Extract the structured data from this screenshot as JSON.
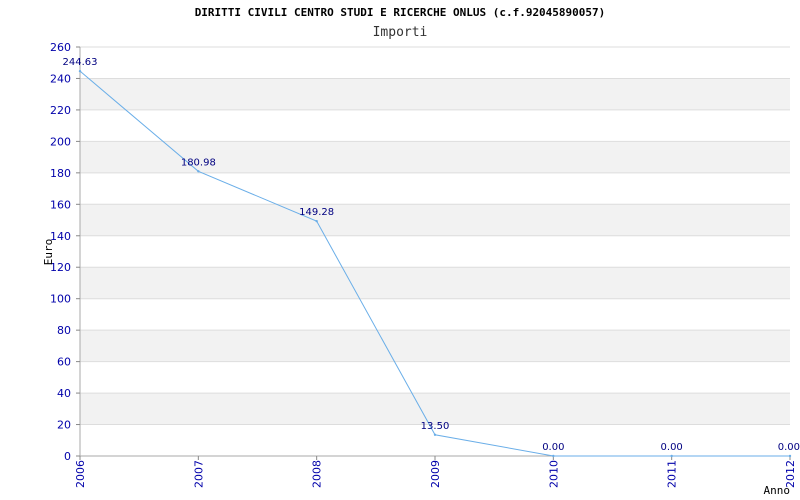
{
  "chart_data": {
    "type": "line",
    "title": "DIRITTI CIVILI CENTRO STUDI E RICERCHE ONLUS (c.f.92045890057)",
    "subtitle": "Importi",
    "xlabel": "Anno",
    "ylabel": "Euro",
    "x": [
      "2006",
      "2007",
      "2008",
      "2009",
      "2010",
      "2011",
      "2012"
    ],
    "values": [
      244.63,
      180.98,
      149.28,
      13.5,
      0.0,
      0.0,
      0.0
    ],
    "value_labels": [
      "244.63",
      "180.98",
      "149.28",
      "13.50",
      "0.00",
      "0.00",
      "0.00"
    ],
    "ylim": [
      0,
      260
    ],
    "yticks": [
      0,
      20,
      40,
      60,
      80,
      100,
      120,
      140,
      160,
      180,
      200,
      220,
      240,
      260
    ],
    "grid": "horizontal alternating bands",
    "line_color": "#6aaee8",
    "band_color": "#f2f2f2",
    "gridline_color": "#dddddd",
    "tick_color": "#0000aa"
  }
}
